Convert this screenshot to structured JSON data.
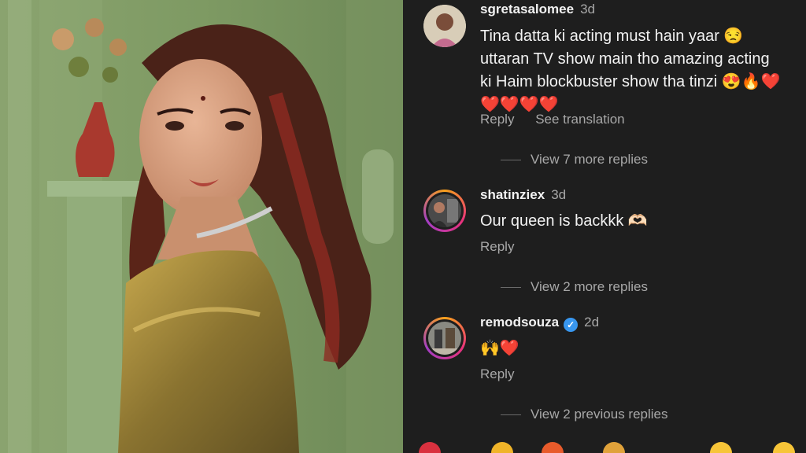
{
  "comments": [
    {
      "username": "sgretasalomee",
      "time": "3d",
      "text_line1": "Tina datta  ki acting must hain yaar 😒",
      "text_line2": "uttaran TV show main tho amazing acting",
      "text_line3": "ki Haim blockbuster show tha tinzi 😍🔥❤️",
      "text_line4": "❤️❤️❤️❤️",
      "reply_label": "Reply",
      "translation_label": "See translation",
      "more_replies": "View 7 more replies"
    },
    {
      "username": "shatinziex",
      "time": "3d",
      "text": "Our queen is backkk 🫶🏻",
      "reply_label": "Reply",
      "more_replies": "View 2 more replies"
    },
    {
      "username": "remodsouza",
      "time": "2d",
      "verified": true,
      "text": "🙌❤️",
      "reply_label": "Reply",
      "more_replies": "View 2 previous replies"
    }
  ],
  "colors": {
    "background": "#1e1e1e",
    "text": "#f2f2f2",
    "muted": "#a8a8a8",
    "verified": "#3897f0"
  }
}
